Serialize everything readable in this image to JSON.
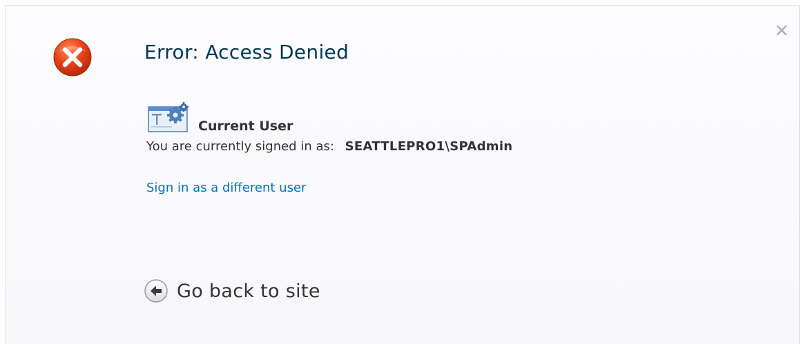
{
  "dialog": {
    "title": "Error: Access Denied",
    "close_icon": "close-icon",
    "error_icon": "error-icon",
    "colors": {
      "title": "#003759",
      "link": "#0072bc",
      "error": "#e8421a",
      "text": "#333333"
    }
  },
  "current_user": {
    "icon": "user-settings-icon",
    "heading": "Current User",
    "signed_in_prefix": "You are currently signed in as:",
    "signed_in_value": "SEATTLEPRO1\\SPAdmin",
    "switch_link": "Sign in as a different user"
  },
  "footer": {
    "back_icon": "back-arrow-icon",
    "back_label": "Go back to site"
  }
}
